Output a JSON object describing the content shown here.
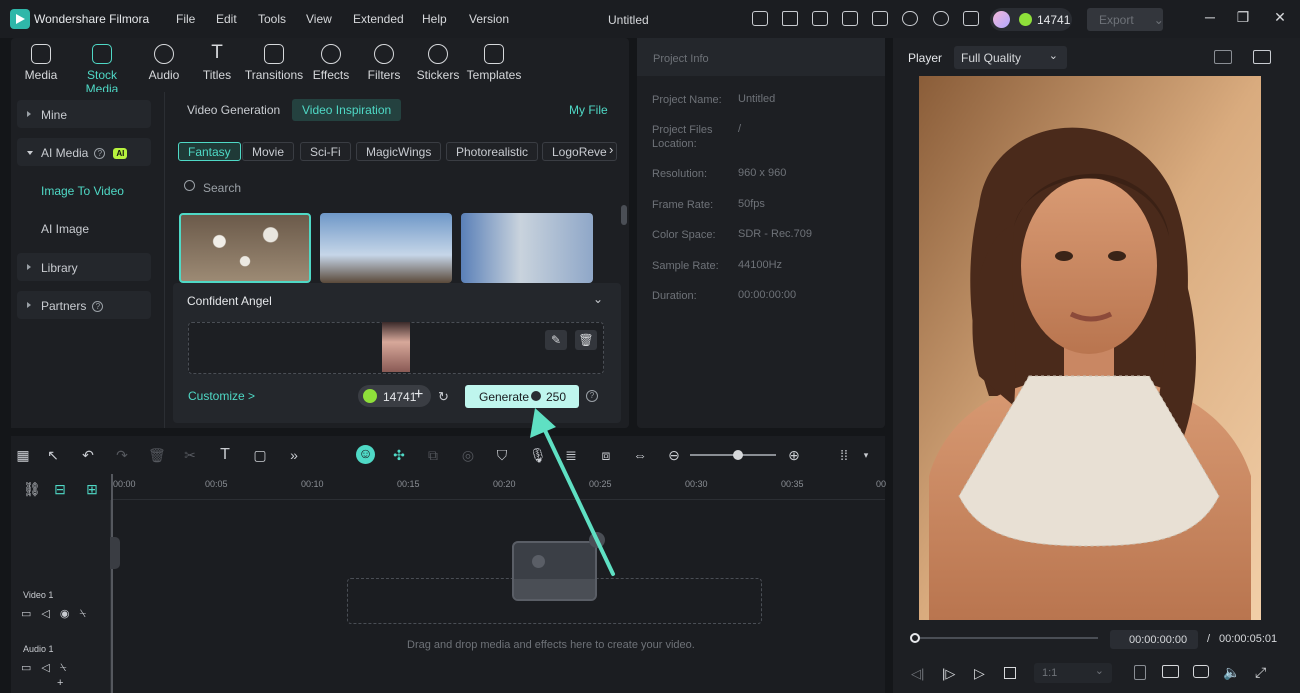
{
  "titlebar": {
    "app_name": "Wondershare Filmora",
    "menus": [
      "File",
      "Edit",
      "Tools",
      "View",
      "Extended",
      "Help",
      "Version"
    ],
    "doc_title": "Untitled",
    "credits": "14741",
    "export_label": "Export"
  },
  "media_tabs": [
    "Media",
    "Stock Media",
    "Audio",
    "Titles",
    "Transitions",
    "Effects",
    "Filters",
    "Stickers",
    "Templates"
  ],
  "sidebar": {
    "mine": "Mine",
    "ai_media": "AI Media",
    "ai_badge": "AI",
    "image_to_video": "Image To Video",
    "ai_image": "AI Image",
    "library": "Library",
    "partners": "Partners"
  },
  "content": {
    "tab_generation": "Video Generation",
    "tab_inspiration": "Video Inspiration",
    "my_file": "My File",
    "chips": [
      "Fantasy",
      "Movie",
      "Sci-Fi",
      "MagicWings",
      "Photorealistic",
      "LogoReve"
    ],
    "search_placeholder": "Search",
    "card_title": "Confident Angel",
    "customize": "Customize >",
    "credits": "14741",
    "generate_label": "Generate",
    "generate_cost": "250"
  },
  "project_info": {
    "header": "Project Info",
    "rows": [
      {
        "label": "Project Name:",
        "value": "Untitled"
      },
      {
        "label": "Project Files Location:",
        "value": "/"
      },
      {
        "label": "Resolution:",
        "value": "960 x 960"
      },
      {
        "label": "Frame Rate:",
        "value": "50fps"
      },
      {
        "label": "Color Space:",
        "value": "SDR - Rec.709"
      },
      {
        "label": "Sample Rate:",
        "value": "44100Hz"
      },
      {
        "label": "Duration:",
        "value": "00:00:00:00"
      }
    ]
  },
  "player": {
    "label": "Player",
    "quality": "Full Quality",
    "current_time": "00:00:00:00",
    "separator": "/",
    "total_time": "00:00:05:01",
    "ratio": "1:1"
  },
  "timeline": {
    "ticks": [
      "00:00",
      "00:05",
      "00:10",
      "00:15",
      "00:20",
      "00:25",
      "00:30",
      "00:35",
      "00"
    ],
    "video_track": "Video 1",
    "audio_track": "Audio 1",
    "drop_hint": "Drag and drop media and effects here to create your video."
  },
  "colors": {
    "accent": "#4fd9c6",
    "annotation_arrow": "#5fe0c3",
    "credit_coin": "#8fe03a"
  }
}
